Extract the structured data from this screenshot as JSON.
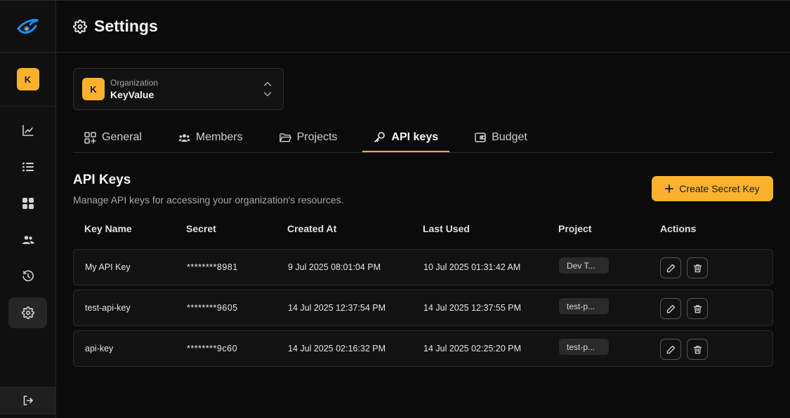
{
  "header": {
    "title": "Settings",
    "icon": "gear-icon"
  },
  "sidebar": {
    "avatar_letter": "K",
    "items": [
      {
        "name": "analytics",
        "icon": "chart-line-icon"
      },
      {
        "name": "logs",
        "icon": "list-icon"
      },
      {
        "name": "dashboard",
        "icon": "grid-icon"
      },
      {
        "name": "users",
        "icon": "users-icon"
      },
      {
        "name": "history",
        "icon": "history-icon"
      },
      {
        "name": "settings",
        "icon": "gear-icon",
        "active": true
      }
    ],
    "logout_icon": "logout-icon"
  },
  "org": {
    "label": "Organization",
    "name": "KeyValue",
    "avatar_letter": "K"
  },
  "tabs": [
    {
      "label": "General",
      "icon": "grid-plus-icon"
    },
    {
      "label": "Members",
      "icon": "users-icon"
    },
    {
      "label": "Projects",
      "icon": "folder-icon"
    },
    {
      "label": "API keys",
      "icon": "key-icon",
      "active": true
    },
    {
      "label": "Budget",
      "icon": "wallet-icon"
    }
  ],
  "section": {
    "title": "API Keys",
    "description": "Manage API keys for accessing your organization's resources.",
    "create_button": "Create Secret Key"
  },
  "table": {
    "columns": [
      "Key Name",
      "Secret",
      "Created At",
      "Last Used",
      "Project",
      "Actions"
    ],
    "rows": [
      {
        "name": "My API Key",
        "secret": "********8981",
        "created": "9 Jul 2025 08:01:04 PM",
        "last_used": "10 Jul 2025 01:31:42 AM",
        "project": "Dev T..."
      },
      {
        "name": "test-api-key",
        "secret": "********9605",
        "created": "14 Jul 2025 12:37:54 PM",
        "last_used": "14 Jul 2025 12:37:55 PM",
        "project": "test-p..."
      },
      {
        "name": "api-key",
        "secret": "********9c60",
        "created": "14 Jul 2025 02:16:32 PM",
        "last_used": "14 Jul 2025 02:25:20 PM",
        "project": "test-p..."
      }
    ]
  },
  "colors": {
    "accent": "#fbb12e",
    "background": "#0b0b0b",
    "panel": "#121212"
  }
}
